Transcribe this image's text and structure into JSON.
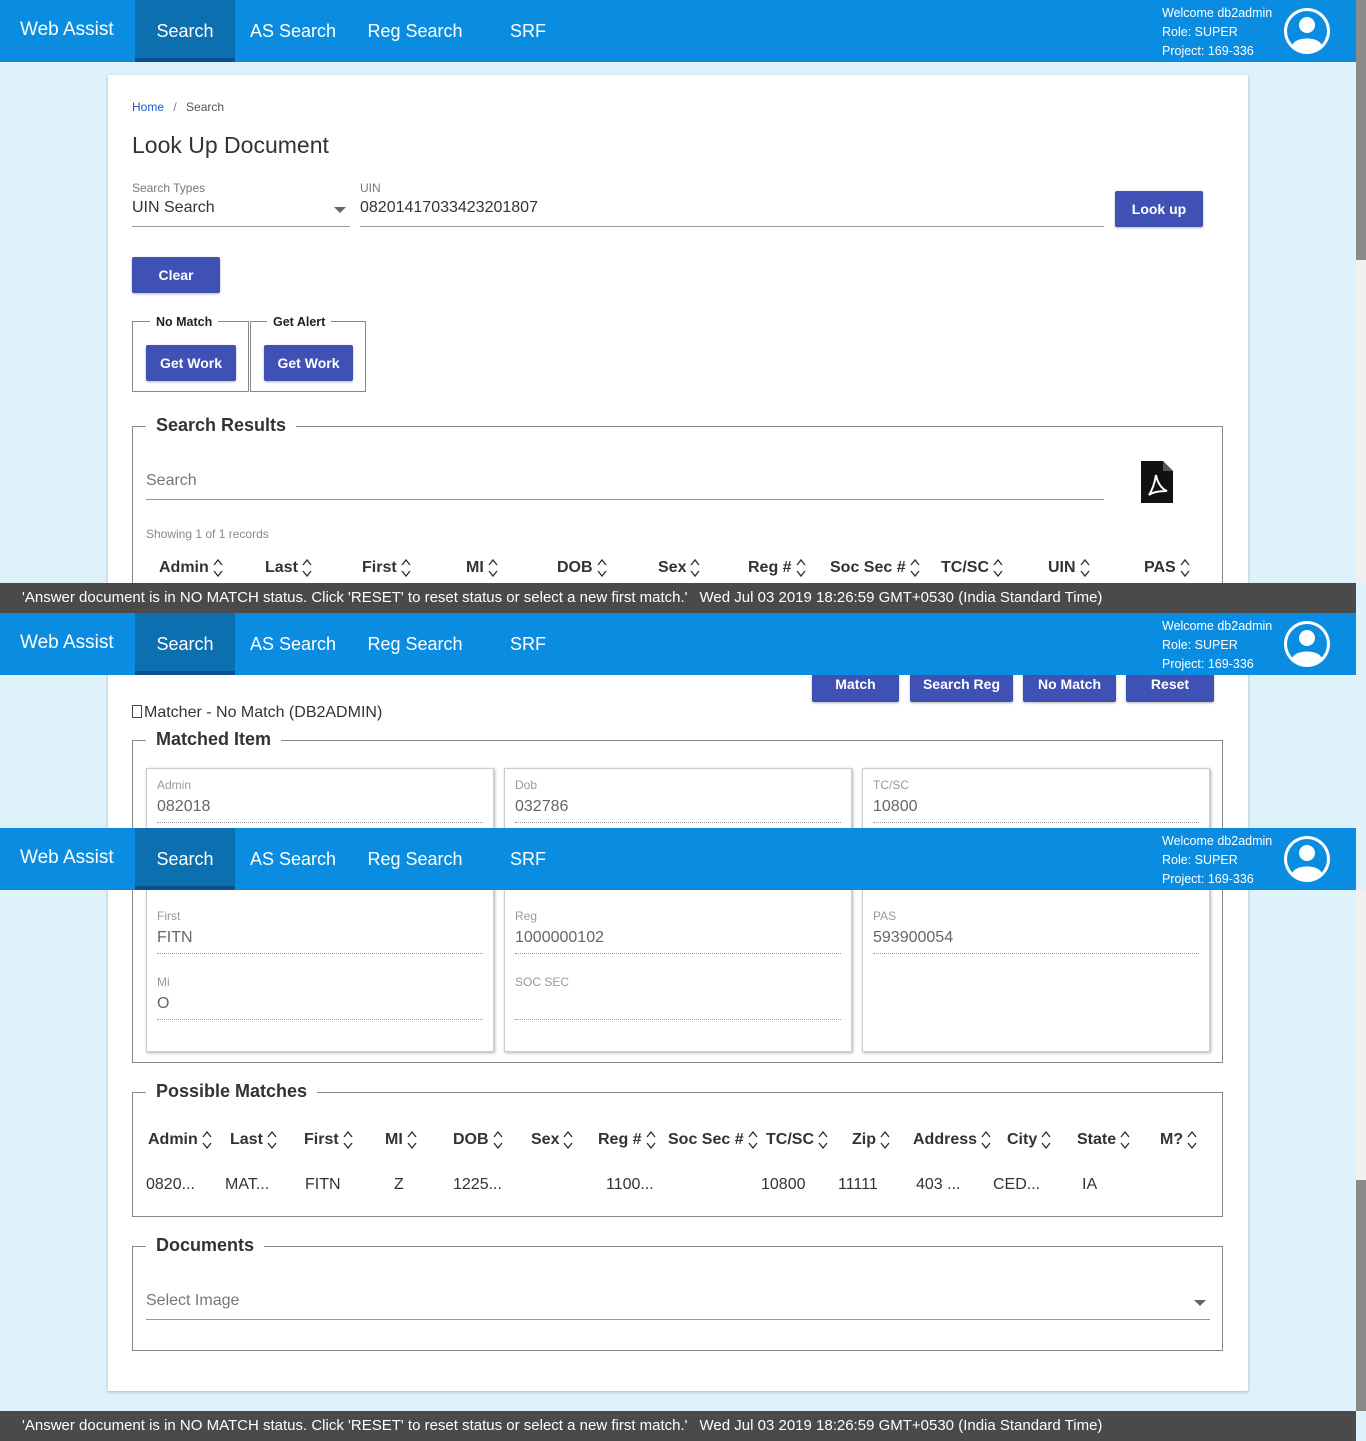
{
  "nav": {
    "brand": "Web Assist",
    "tabs": [
      "Search",
      "AS Search",
      "Reg Search",
      "SRF"
    ],
    "user": {
      "welcome": "Welcome db2admin",
      "role": "Role: SUPER",
      "project": "Project: 169-336"
    }
  },
  "breadcrumb": {
    "home": "Home",
    "sep": "/",
    "current": "Search"
  },
  "page_title": "Look Up Document",
  "search_form": {
    "type_label": "Search Types",
    "type_value": "UIN Search",
    "uin_label": "UIN",
    "uin_value": "0820141703342320180​7",
    "lookup_label": "Look up",
    "clear_label": "Clear"
  },
  "queues": [
    {
      "label": "No Match",
      "button": "Get Work"
    },
    {
      "label": "Get Alert",
      "button": "Get Work"
    }
  ],
  "search_results": {
    "title": "Search Results",
    "search_placeholder": "Search",
    "record_count": "Showing 1 of 1 records",
    "columns": [
      "Admin",
      "Last",
      "First",
      "MI",
      "DOB",
      "Sex",
      "Reg #",
      "Soc Sec #",
      "TC/SC",
      "UIN",
      "PAS"
    ]
  },
  "status_message": "'Answer document is in NO MATCH status. Click 'RESET' to reset status or select a new first match.'",
  "status_time": "Wed Jul 03 2019 18:26:59 GMT+0530 (India Standard Time)",
  "actions": [
    "Match",
    "Search Reg",
    "No Match",
    "Reset"
  ],
  "matcher_status": "Matcher - No Match (DB2ADMIN)",
  "matched_item": {
    "title": "Matched Item",
    "top_row": [
      {
        "label": "Admin",
        "value": "082018"
      },
      {
        "label": "Dob",
        "value": "032786"
      },
      {
        "label": "TC/SC",
        "value": "10800"
      }
    ],
    "col1": [
      {
        "label": "First",
        "value": "FITN"
      },
      {
        "label": "Mi",
        "value": "O"
      }
    ],
    "col2": [
      {
        "label": "Reg",
        "value": "1000000102"
      },
      {
        "label": "SOC SEC",
        "value": ""
      }
    ],
    "col3": [
      {
        "label": "PAS",
        "value": "593900054"
      }
    ]
  },
  "possible_matches": {
    "title": "Possible Matches",
    "columns": [
      "Admin",
      "Last",
      "First",
      "MI",
      "DOB",
      "Sex",
      "Reg #",
      "Soc Sec #",
      "TC/SC",
      "Zip",
      "Address",
      "City",
      "State",
      "M?"
    ],
    "row": [
      "0820...",
      "MAT...",
      "FITN",
      "Z",
      "1225...",
      "",
      "1100...",
      "",
      "10800",
      "11111",
      "403 ...",
      "CED...",
      "IA",
      ""
    ]
  },
  "documents": {
    "title": "Documents",
    "select_placeholder": "Select Image"
  }
}
